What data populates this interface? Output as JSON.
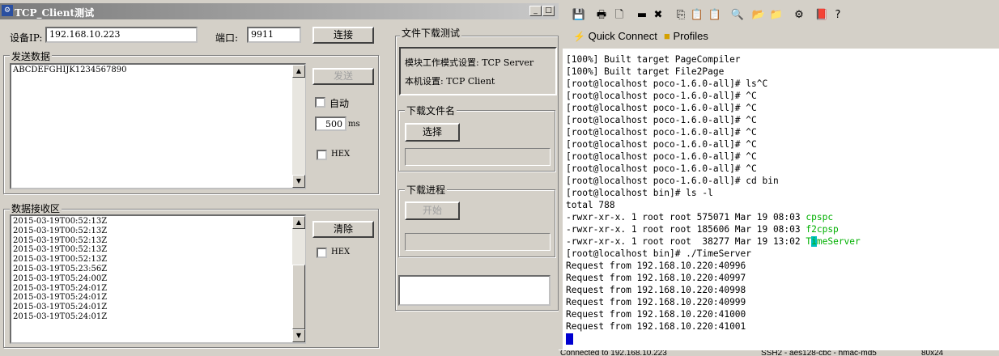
{
  "left_app": {
    "title": "TCP_Client测试",
    "device_ip_label": "设备IP:",
    "device_ip_value": "192.168.10.223",
    "port_label": "端口:",
    "port_value": "9911",
    "connect_button": "连接",
    "send_group_title": "发送数据",
    "send_text": "ABCDEFGHIJK1234567890",
    "send_button": "发送",
    "auto_label": "自动",
    "interval_value": "500",
    "interval_unit": "ms",
    "hex_label": "HEX",
    "receive_group_title": "数据接收区",
    "receive_lines": [
      "2015-03-19T00:52:13Z",
      "2015-03-19T00:52:13Z",
      "2015-03-19T00:52:13Z",
      "2015-03-19T00:52:13Z",
      "2015-03-19T00:52:13Z",
      "2015-03-19T05:23:56Z",
      "2015-03-19T05:24:00Z",
      "2015-03-19T05:24:01Z",
      "2015-03-19T05:24:01Z",
      "2015-03-19T05:24:01Z",
      "2015-03-19T05:24:01Z"
    ],
    "clear_button": "清除",
    "download_group_title": "文件下载测试",
    "mode_setting": "模块工作模式设置: TCP Server",
    "local_setting": "本机设置: TCP Client",
    "filename_group_title": "下载文件名",
    "select_button": "选择",
    "progress_group_title": "下载进程",
    "start_button": "开始"
  },
  "terminal_app": {
    "toolbar_icons": [
      "save-icon",
      "print-icon",
      "print-preview-icon",
      "disconnect-icon",
      "reconnect-icon",
      "copy-icon",
      "paste-icon",
      "copy-paste-icon",
      "find-icon",
      "sftp-icon",
      "terminal-options-icon",
      "settings-icon",
      "keymap-icon",
      "help-icon"
    ],
    "quick_connect": "Quick Connect",
    "profiles": "Profiles",
    "lines": [
      "[100%] Built target PageCompiler",
      "[100%] Built target File2Page",
      "[root@localhost poco-1.6.0-all]# ls^C",
      "[root@localhost poco-1.6.0-all]# ^C",
      "[root@localhost poco-1.6.0-all]# ^C",
      "[root@localhost poco-1.6.0-all]# ^C",
      "[root@localhost poco-1.6.0-all]# ^C",
      "[root@localhost poco-1.6.0-all]# ^C",
      "[root@localhost poco-1.6.0-all]# ^C",
      "[root@localhost poco-1.6.0-all]# ^C",
      "[root@localhost poco-1.6.0-all]# cd bin",
      "[root@localhost bin]# ls -l",
      "total 788"
    ],
    "ls_rows": [
      {
        "prefix": "-rwxr-xr-x. 1 root root 575071 Mar 19 08:03 ",
        "name": "cpspc"
      },
      {
        "prefix": "-rwxr-xr-x. 1 root root 185606 Mar 19 08:03 ",
        "name": "f2cpsp"
      },
      {
        "prefix": "-rwxr-xr-x. 1 root root  38277 Mar 19 13:02 ",
        "name": "TimeServer"
      }
    ],
    "lines_after": [
      "[root@localhost bin]# ./TimeServer",
      "Request from 192.168.10.220:40996",
      "Request from 192.168.10.220:40997",
      "Request from 192.168.10.220:40998",
      "Request from 192.168.10.220:40999",
      "Request from 192.168.10.220:41000",
      "Request from 192.168.10.220:41001"
    ],
    "status_connected": "Connected to 192.168.10.223",
    "status_protocol": "SSH2 - aes128-cbc - hmac-md5",
    "status_size": "80x24"
  }
}
